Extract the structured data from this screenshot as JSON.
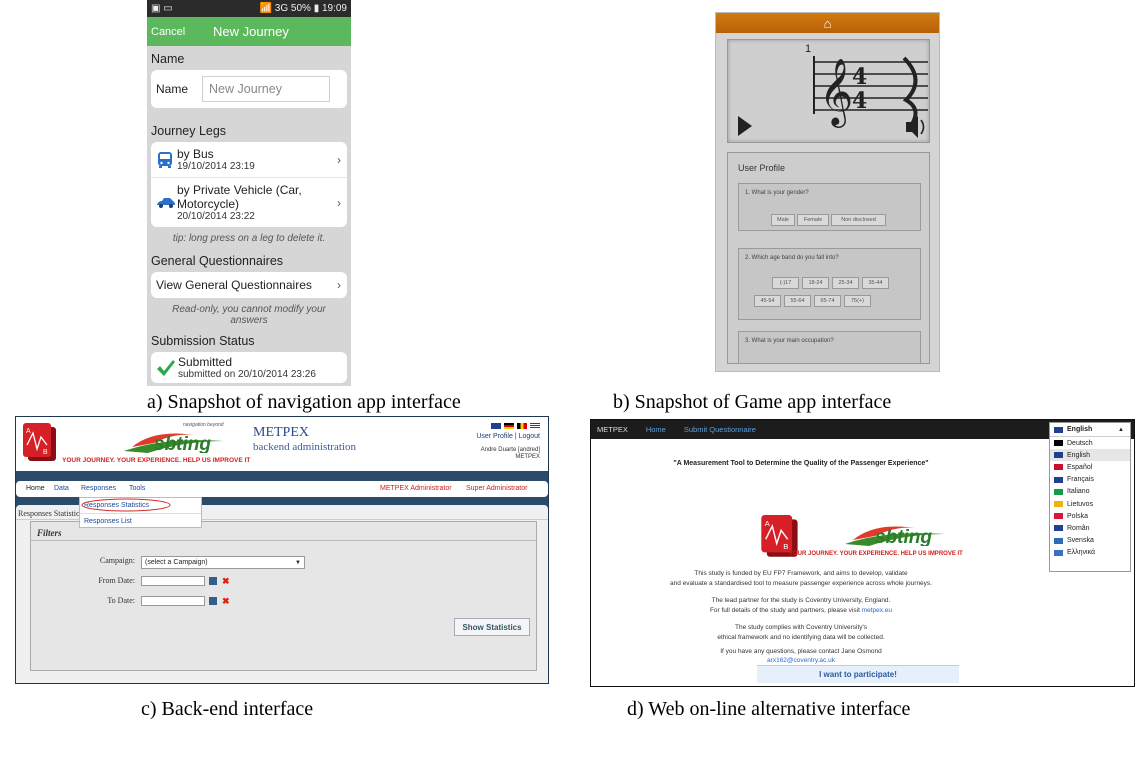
{
  "panel_a": {
    "status": {
      "left_icons": "▣ ▭",
      "right": "📶 3G 50% ▮ 19:09"
    },
    "appbar": {
      "cancel": "Cancel",
      "title": "New Journey"
    },
    "name_section": "Name",
    "name_label": "Name",
    "name_placeholder": "New Journey",
    "legs_section": "Journey Legs",
    "legs": [
      {
        "title": "by Bus",
        "date": "19/10/2014 23:19",
        "icon": "bus-icon"
      },
      {
        "title": "by Private Vehicle (Car, Motorcycle)",
        "date": "20/10/2014 23:22",
        "icon": "car-icon"
      }
    ],
    "tip": "tip: long press on a leg to delete it.",
    "general_section": "General Questionnaires",
    "view_general": "View General Questionnaires",
    "readonly_note": "Read-only, you cannot modify your answers",
    "submission_section": "Submission Status",
    "submitted": "Submitted",
    "submitted_on": "submitted on 20/10/2014 23:26"
  },
  "panel_b": {
    "home_icon": "home-icon",
    "measure_number": "1",
    "profile_title": "User Profile",
    "q1": "1. What is your gender?",
    "gender_options": [
      "Male",
      "Female",
      "Non disclosed"
    ],
    "q2": "2. Which age band do you fall into?",
    "age_row1": [
      "(-)17",
      "18-24",
      "25-34",
      "35-44"
    ],
    "age_row2": [
      "45-54",
      "55-64",
      "65-74",
      "75(+)"
    ],
    "q3": "3. What is your main occupation?"
  },
  "panel_c": {
    "logo_tagline": "YOUR JOURNEY. YOUR EXPERIENCE. HELP US IMPROVE IT",
    "logo_small": "navigation beyond",
    "title": "METPEX",
    "subtitle": "backend administration",
    "user_links": "User Profile | Logout",
    "user_name": "Andre Duarte [andred]",
    "user_org": "METPEX",
    "nav": [
      "Home",
      "Data",
      "Responses",
      "Tools"
    ],
    "admin_links": [
      "METPEX Administrator",
      "Super Administrator"
    ],
    "dropdown": [
      "Responses Statistics",
      "Responses List"
    ],
    "section_title": "Responses Statistics",
    "filters_title": "Filters",
    "campaign_label": "Campaign:",
    "campaign_value": "(select a Campaign)",
    "from_label": "From Date:",
    "to_label": "To Date:",
    "show_button": "Show Statistics"
  },
  "panel_d": {
    "nav": [
      "METPEX",
      "Home",
      "Submit Questionnaire"
    ],
    "heading": "\"A Measurement Tool to Determine the Quality of the Passenger Experience\"",
    "logo_tagline": "YOUR JOURNEY. YOUR EXPERIENCE. HELP US IMPROVE IT",
    "p1a": "This study is funded by EU FP7 Framework, and aims to develop, validate",
    "p1b": "and evaluate a standardised tool to measure passenger experience across whole journeys.",
    "p2a": "The lead partner for the study is Coventry University, England.",
    "p2b_pre": "For full details of the study and partners, please visit ",
    "p2b_link": "metpex.eu",
    "p3a": "The study complies with Coventry University's",
    "p3b": "ethical framework and no identifying data will be collected.",
    "p4a": "If you have any questions, please contact Jane Osmond",
    "p4b": "arx162@coventry.ac.uk",
    "participate": "I want to participate!",
    "lang_selected": "English",
    "languages": [
      "Deutsch",
      "English",
      "Español",
      "Français",
      "Italiano",
      "Lietuvos",
      "Polska",
      "Român",
      "Svenska",
      "Ελληνικά"
    ],
    "language_colors": [
      "#000000",
      "#1f3f8f",
      "#c8102e",
      "#1f3f8f",
      "#139b4a",
      "#f2b20c",
      "#dc143c",
      "#1f3f8f",
      "#2a6db5",
      "#3b6fc4"
    ]
  },
  "captions": {
    "a": "a) Snapshot of navigation app interface",
    "b": "b)   Snapshot of Game app interface",
    "c": "c)   Back-end interface",
    "d": "d) Web on-line alternative interface"
  }
}
